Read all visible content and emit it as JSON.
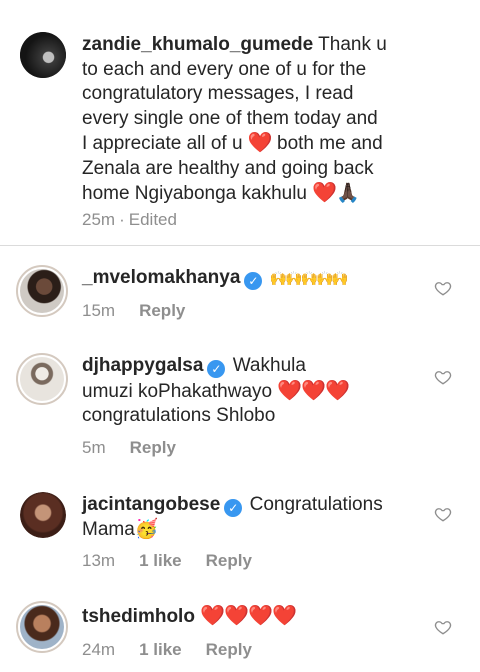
{
  "caption": {
    "username": "zandie_khumalo_gumede",
    "line1": "Thank u",
    "line2": "to each and every one of u for the",
    "line3": "congratulatory messages, I read",
    "line4": "every single one of them today and",
    "line5a": "I appreciate all of u",
    "line5b": "both me and",
    "line6": "Zenala are healthy and going back",
    "line7": "home Ngiyabonga kakhulu",
    "heart": "❤️",
    "hands": "🙏🏿",
    "time": "25m",
    "sep": "·",
    "edited": "Edited"
  },
  "comments": [
    {
      "username": "_mvelomakhanya",
      "text": "🙌🙌🙌🙌🙌",
      "time": "15m",
      "reply": "Reply"
    },
    {
      "username": "djhappygalsa",
      "line1": "Wakhula",
      "line2a": "umuzi koPhakathwayo",
      "line2b": "❤️❤️❤️",
      "line3": "congratulations Shlobo",
      "time": "5m",
      "reply": "Reply"
    },
    {
      "username": "jacintangobese",
      "line1": "Congratulations",
      "line2": "Mama🥳",
      "time": "13m",
      "likes": "1 like",
      "reply": "Reply"
    },
    {
      "username": "tshedimholo",
      "text": "❤️❤️❤️❤️",
      "time": "24m",
      "likes": "1 like",
      "reply": "Reply"
    }
  ],
  "icons": {
    "verified": "✓"
  },
  "colors": {
    "heart": "#e0191f",
    "verified": "#3897f0",
    "meta": "#8e8e8e"
  }
}
